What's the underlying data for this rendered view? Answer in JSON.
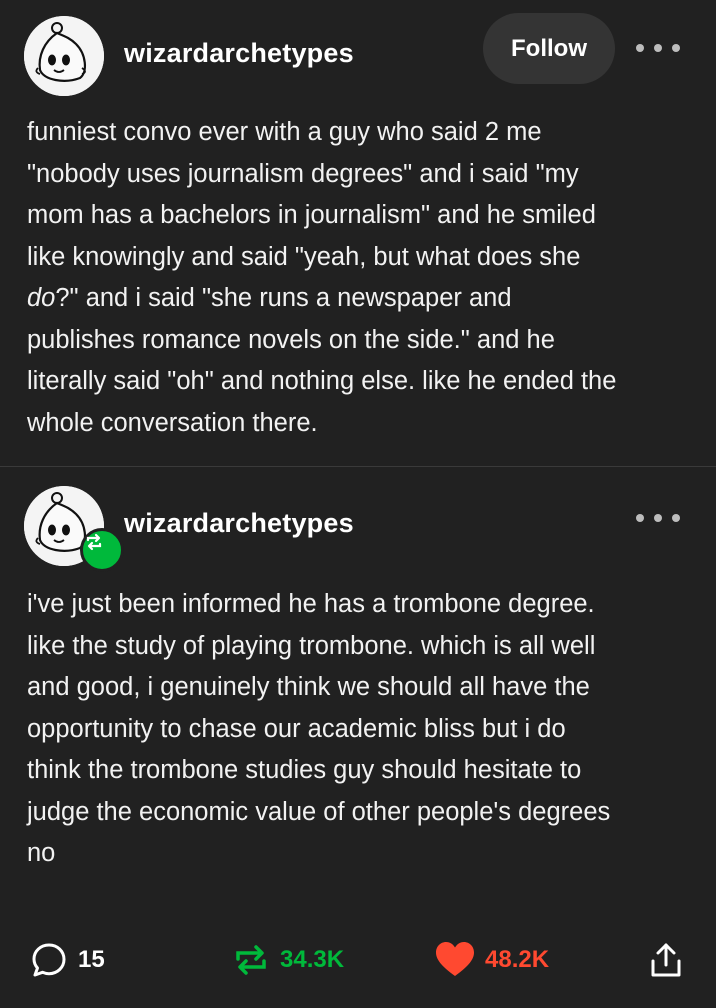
{
  "post": {
    "username": "wizardarchetypes",
    "follow_label": "Follow",
    "lines": [
      "funniest convo ever with a guy who said 2 me",
      "\"nobody uses journalism degrees\" and i said \"my",
      "mom has a bachelors in journalism\" and he smiled",
      "like knowingly and said \"yeah, but what does she",
      [
        "do",
        "?\" and i said \"she runs a newspaper and"
      ],
      "publishes romance novels on the side.\" and he",
      "literally said \"oh\" and nothing else. like he ended the",
      "whole conversation there."
    ]
  },
  "reblog": {
    "username": "wizardarchetypes",
    "lines": [
      "i've just been informed he has a trombone degree.",
      "like the study of playing trombone. which is all well",
      "and good, i genuinely think we should all have the",
      "opportunity to chase our academic bliss but i do",
      "think the trombone studies guy should hesitate to",
      "judge the economic value of other people's degrees",
      "no"
    ]
  },
  "footer": {
    "comments": "15",
    "reblogs": "34.3K",
    "likes": "48.2K"
  },
  "colors": {
    "background": "#212121",
    "reblog_green": "#00b93b",
    "like_red": "#ff4930"
  },
  "icons": [
    "more-icon",
    "reblog-badge-icon",
    "comment-icon",
    "reblog-icon",
    "heart-icon",
    "share-icon"
  ]
}
